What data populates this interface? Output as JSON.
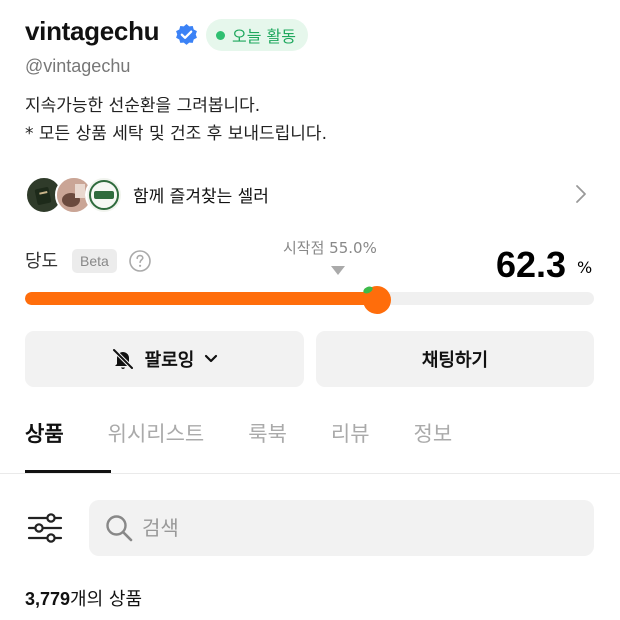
{
  "profile": {
    "username": "vintagechu",
    "handle": "@vintagechu",
    "status_label": "오늘 활동",
    "bio_lines": [
      "지속가능한 선순환을 그려봅니다.",
      "* 모든 상품 세탁 및 건조 후 보내드립니다."
    ]
  },
  "sellers": {
    "label": "함께 즐겨찾는 셀러"
  },
  "temperature": {
    "label": "당도",
    "badge": "Beta",
    "start_label": "시작점 55.0%",
    "value": "62.3",
    "unit": "%",
    "fill_percent": 62.3,
    "start_percent": 55.0
  },
  "actions": {
    "follow_label": "팔로잉",
    "chat_label": "채팅하기"
  },
  "tabs": [
    {
      "label": "상품",
      "active": true
    },
    {
      "label": "위시리스트",
      "active": false
    },
    {
      "label": "룩북",
      "active": false
    },
    {
      "label": "리뷰",
      "active": false
    },
    {
      "label": "정보",
      "active": false
    }
  ],
  "search": {
    "placeholder": "검색"
  },
  "products": {
    "count": "3,779",
    "suffix": "개의 상품"
  },
  "colors": {
    "accent": "#ff6d0b",
    "status_green": "#2fbf71",
    "verified_blue": "#3b82f6"
  },
  "icons": [
    "verified-badge-icon",
    "chevron-right-icon",
    "help-icon",
    "bell-off-icon",
    "chevron-down-icon",
    "filter-icon",
    "search-icon",
    "apple-knob-icon"
  ]
}
